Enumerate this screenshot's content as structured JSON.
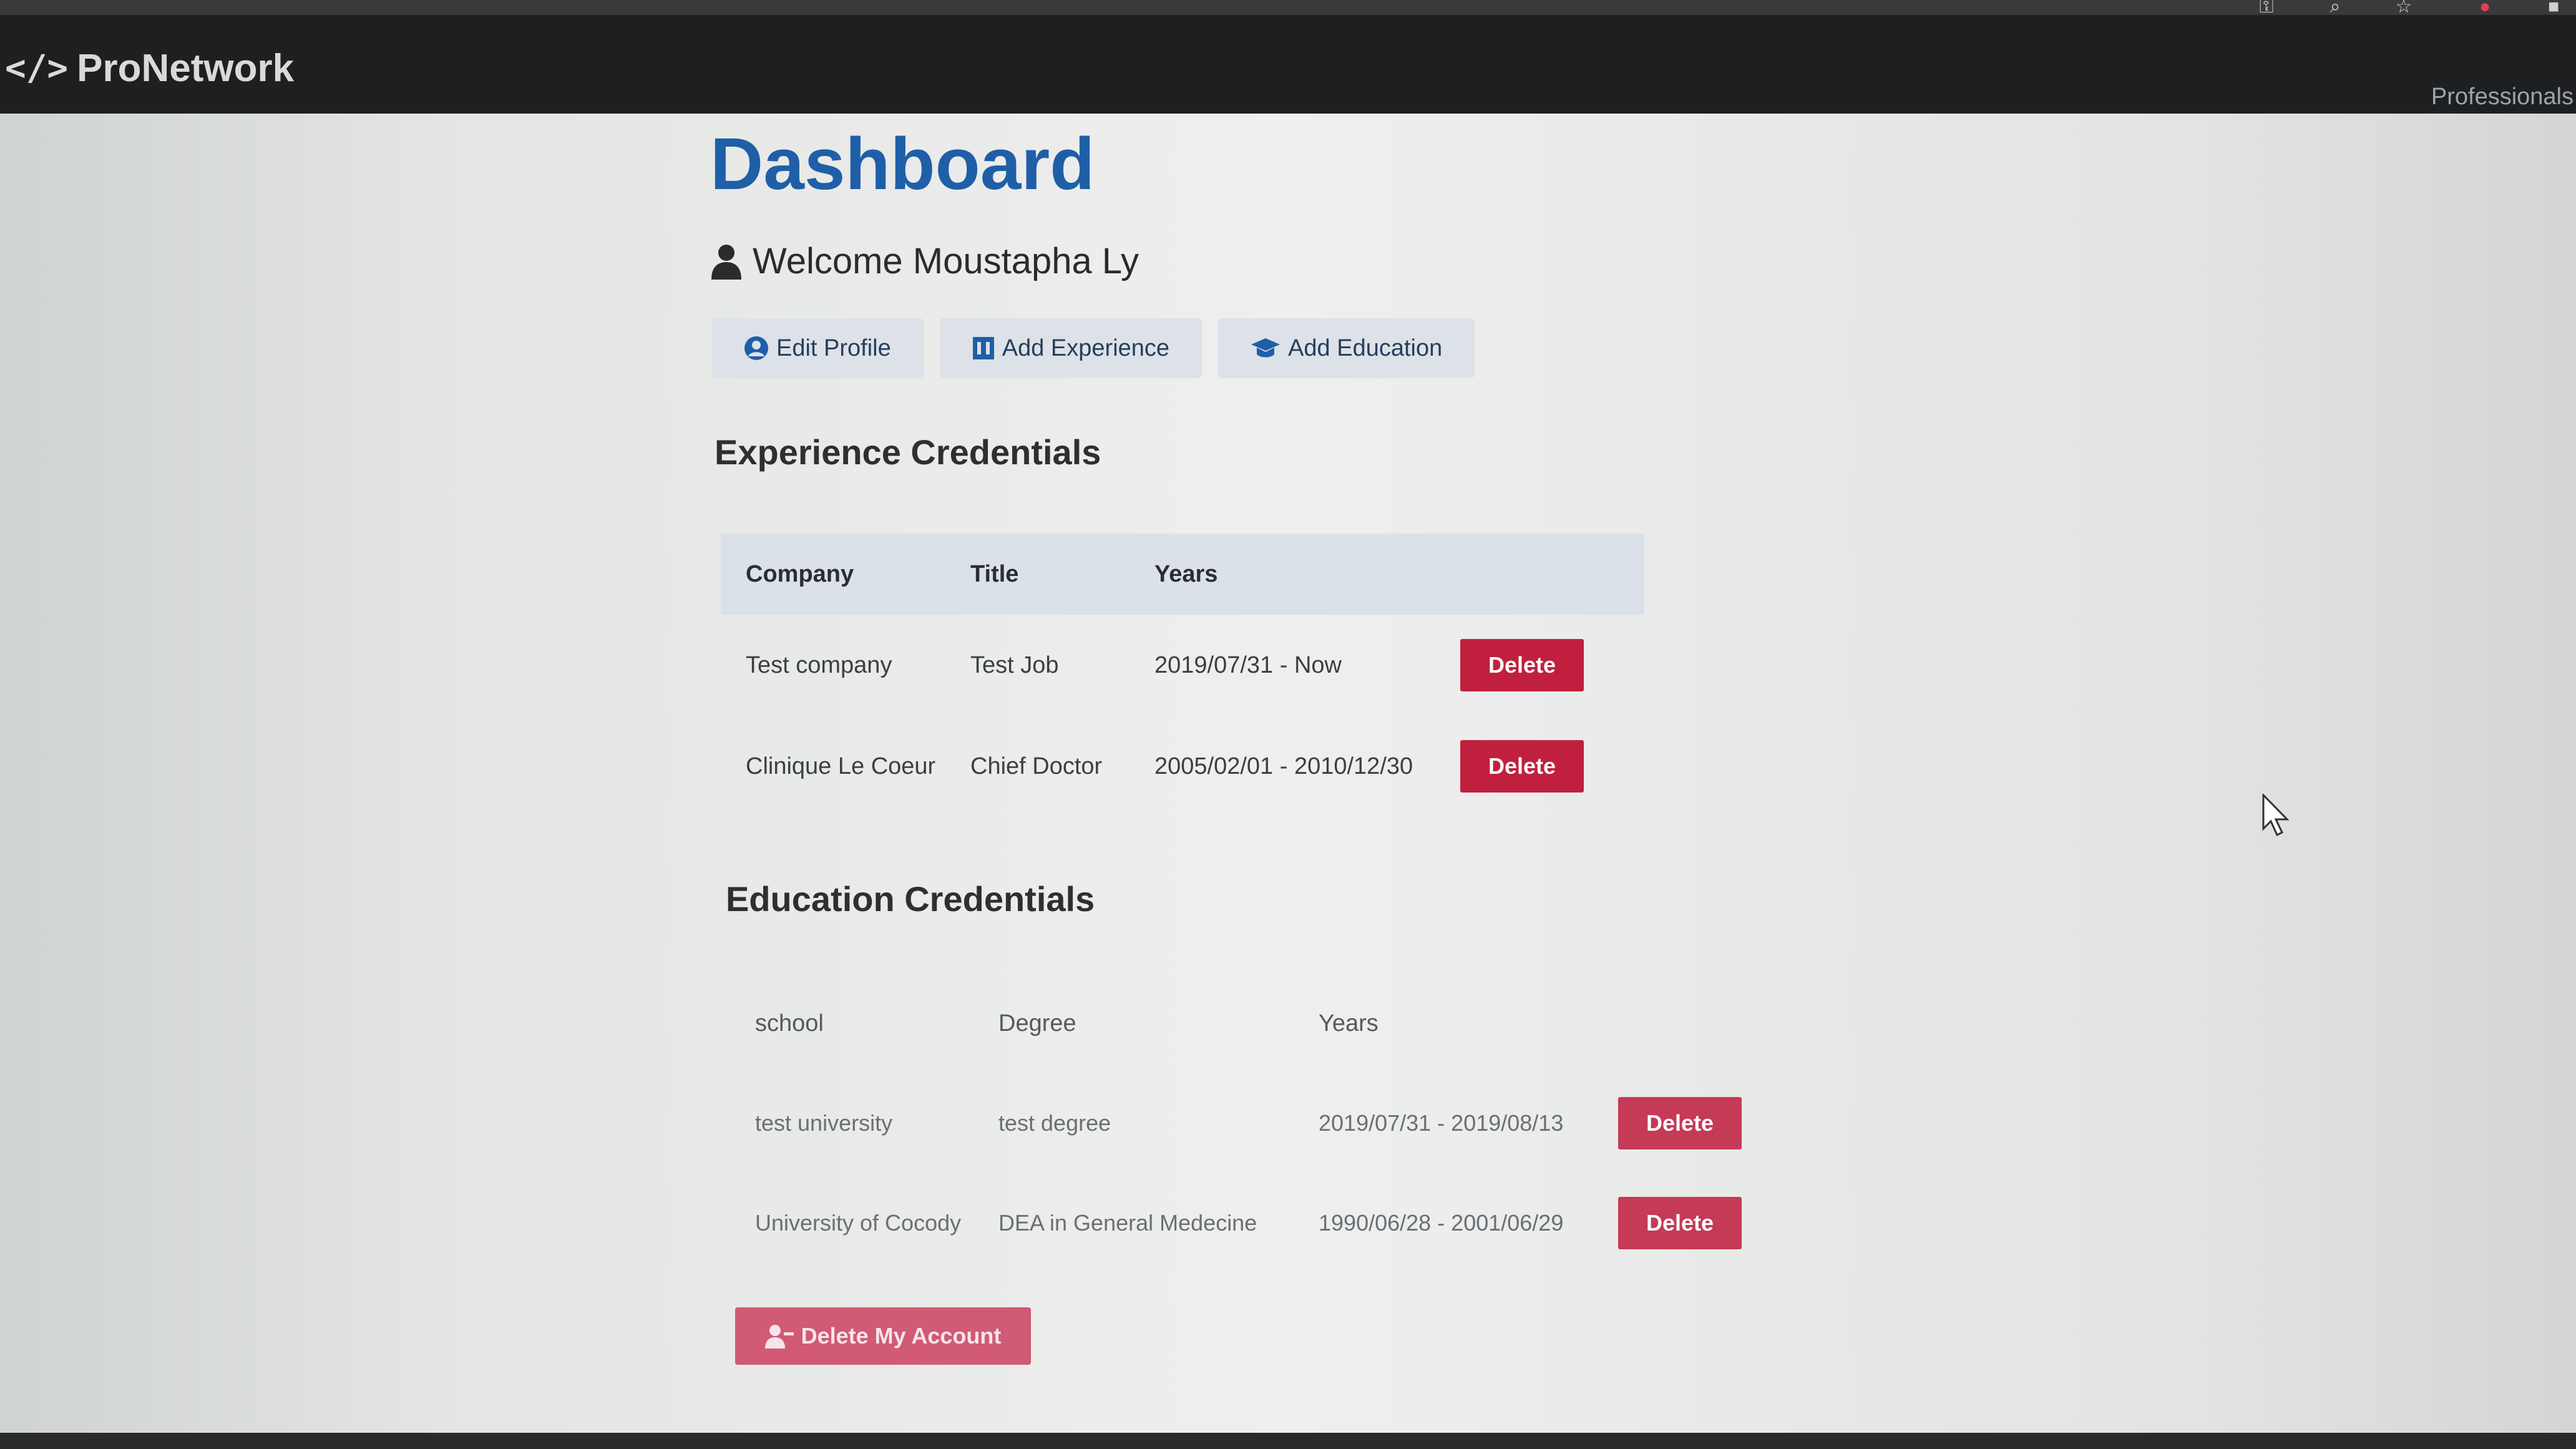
{
  "browser": {
    "icons": [
      "key-icon",
      "magnifier-icon",
      "star-icon",
      "extension-icon",
      "profile-icon"
    ]
  },
  "navbar": {
    "brand_icon": "</>",
    "brand": "ProNetwork",
    "link": "Professionals"
  },
  "dashboard": {
    "title": "Dashboard",
    "welcome": "Welcome Moustapha Ly",
    "actions": {
      "edit_profile": "Edit Profile",
      "add_experience": "Add Experience",
      "add_education": "Add Education"
    }
  },
  "experience": {
    "title": "Experience Credentials",
    "headers": [
      "Company",
      "Title",
      "Years"
    ],
    "rows": [
      {
        "company": "Test company",
        "title": "Test Job",
        "years": "2019/07/31 - Now",
        "action": "Delete"
      },
      {
        "company": "Clinique Le Coeur",
        "title": "Chief Doctor",
        "years": "2005/02/01 - 2010/12/30",
        "action": "Delete"
      }
    ]
  },
  "education": {
    "title": "Education Credentials",
    "headers": [
      "school",
      "Degree",
      "Years"
    ],
    "rows": [
      {
        "school": "test university",
        "degree": "test degree",
        "years": "2019/07/31 - 2019/08/13",
        "action": "Delete"
      },
      {
        "school": "University of Cocody",
        "degree": "DEA in General Medecine",
        "years": "1990/06/28 - 2001/06/29",
        "action": "Delete"
      }
    ]
  },
  "account": {
    "delete_label": "Delete My Account"
  },
  "colors": {
    "navbar": "#1d1f21",
    "title": "#1f5fa8",
    "danger": "#c0203d",
    "light_button": "#dde2e8"
  }
}
